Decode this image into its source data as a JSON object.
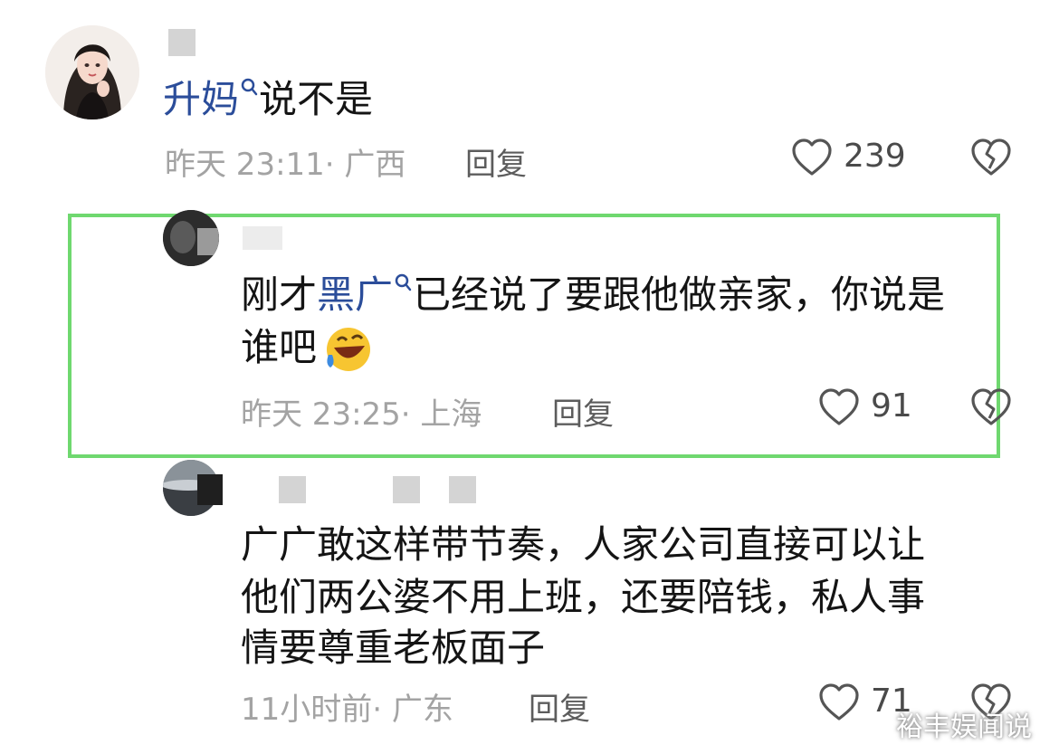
{
  "comments": [
    {
      "link": "升妈",
      "text": "说不是",
      "time": "昨天 23:11·",
      "location": "广西",
      "reply": "回复",
      "likes": "239"
    },
    {
      "prefix": "刚才",
      "link": "黑广",
      "text_line1": "已经说了要跟他做亲家，你说是",
      "text_line2": "谁吧",
      "emoji": "🤣",
      "time": "昨天 23:25·",
      "location": "上海",
      "reply": "回复",
      "likes": "91"
    },
    {
      "lines": [
        "广广敢这样带节奏，人家公司直接可以让",
        "他们两公婆不用上班，还要陪钱，私人事",
        "情要尊重老板面子"
      ],
      "time": "11小时前·",
      "location": "广东",
      "reply": "回复",
      "likes": "71"
    }
  ],
  "watermark": "裕丰娱闻说",
  "colors": {
    "link": "#2b4d9a",
    "highlight_border": "#6fd86f",
    "meta_text": "#a3a3a3"
  },
  "icons": [
    "search-icon",
    "heart-icon",
    "broken-heart-icon"
  ]
}
